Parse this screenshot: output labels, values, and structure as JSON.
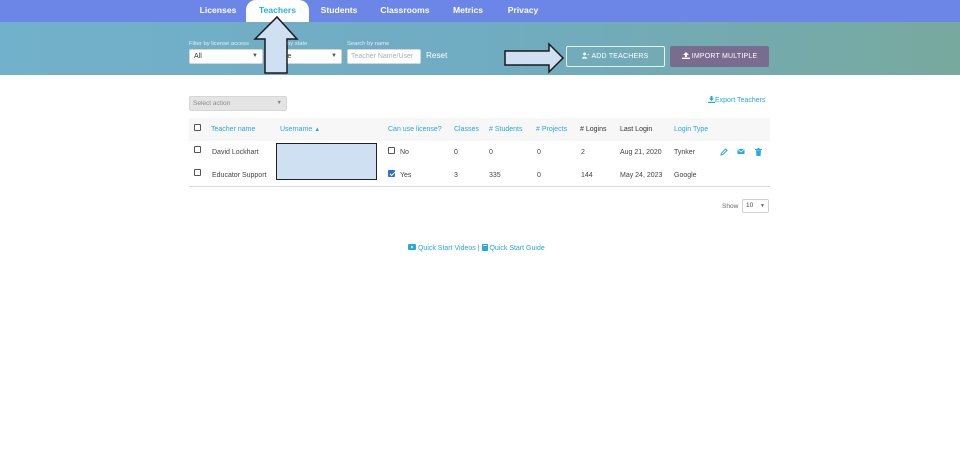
{
  "nav": {
    "tabs": [
      {
        "label": "Licenses",
        "active": false
      },
      {
        "label": "Teachers",
        "active": true
      },
      {
        "label": "Students",
        "active": false
      },
      {
        "label": "Classrooms",
        "active": false
      },
      {
        "label": "Metrics",
        "active": false
      },
      {
        "label": "Privacy",
        "active": false
      }
    ]
  },
  "filters": {
    "license_label": "Filter by license access",
    "license_value": "All",
    "state_label": "by state",
    "state_value": "ve",
    "search_label": "Search by name",
    "search_placeholder": "Teacher Name/User",
    "reset_label": "Reset"
  },
  "actions": {
    "add_teachers": "ADD TEACHERS",
    "import_multiple": "IMPORT MULTIPLE",
    "select_action": "Select action",
    "export_teachers": "Export Teachers"
  },
  "table": {
    "headers": {
      "teacher_name": "Teacher name",
      "username": "Username",
      "can_use_license": "Can use license?",
      "classes": "Classes",
      "students": "# Students",
      "projects": "# Projects",
      "logins": "# Logins",
      "last_login": "Last Login",
      "login_type": "Login Type"
    },
    "rows": [
      {
        "name": "David Lockhart",
        "license_checked": false,
        "license_text": "No",
        "classes": "0",
        "students": "0",
        "projects": "0",
        "logins": "2",
        "last_login": "Aug 21, 2020",
        "login_type": "Tynker"
      },
      {
        "name": "Educator Support",
        "license_checked": true,
        "license_text": "Yes",
        "classes": "3",
        "students": "335",
        "projects": "0",
        "logins": "144",
        "last_login": "May 24, 2023",
        "login_type": "Google"
      }
    ]
  },
  "pager": {
    "show_label": "Show",
    "page_size": "10"
  },
  "footer": {
    "quick_start_videos": "Quick Start Videos",
    "separator": "|",
    "quick_start_guide": "Quick Start Guide"
  },
  "colors": {
    "nav": "#6b86e6",
    "accent": "#27a9dc",
    "import_button": "#7a6c8e",
    "redaction": "#cfe0f2"
  }
}
